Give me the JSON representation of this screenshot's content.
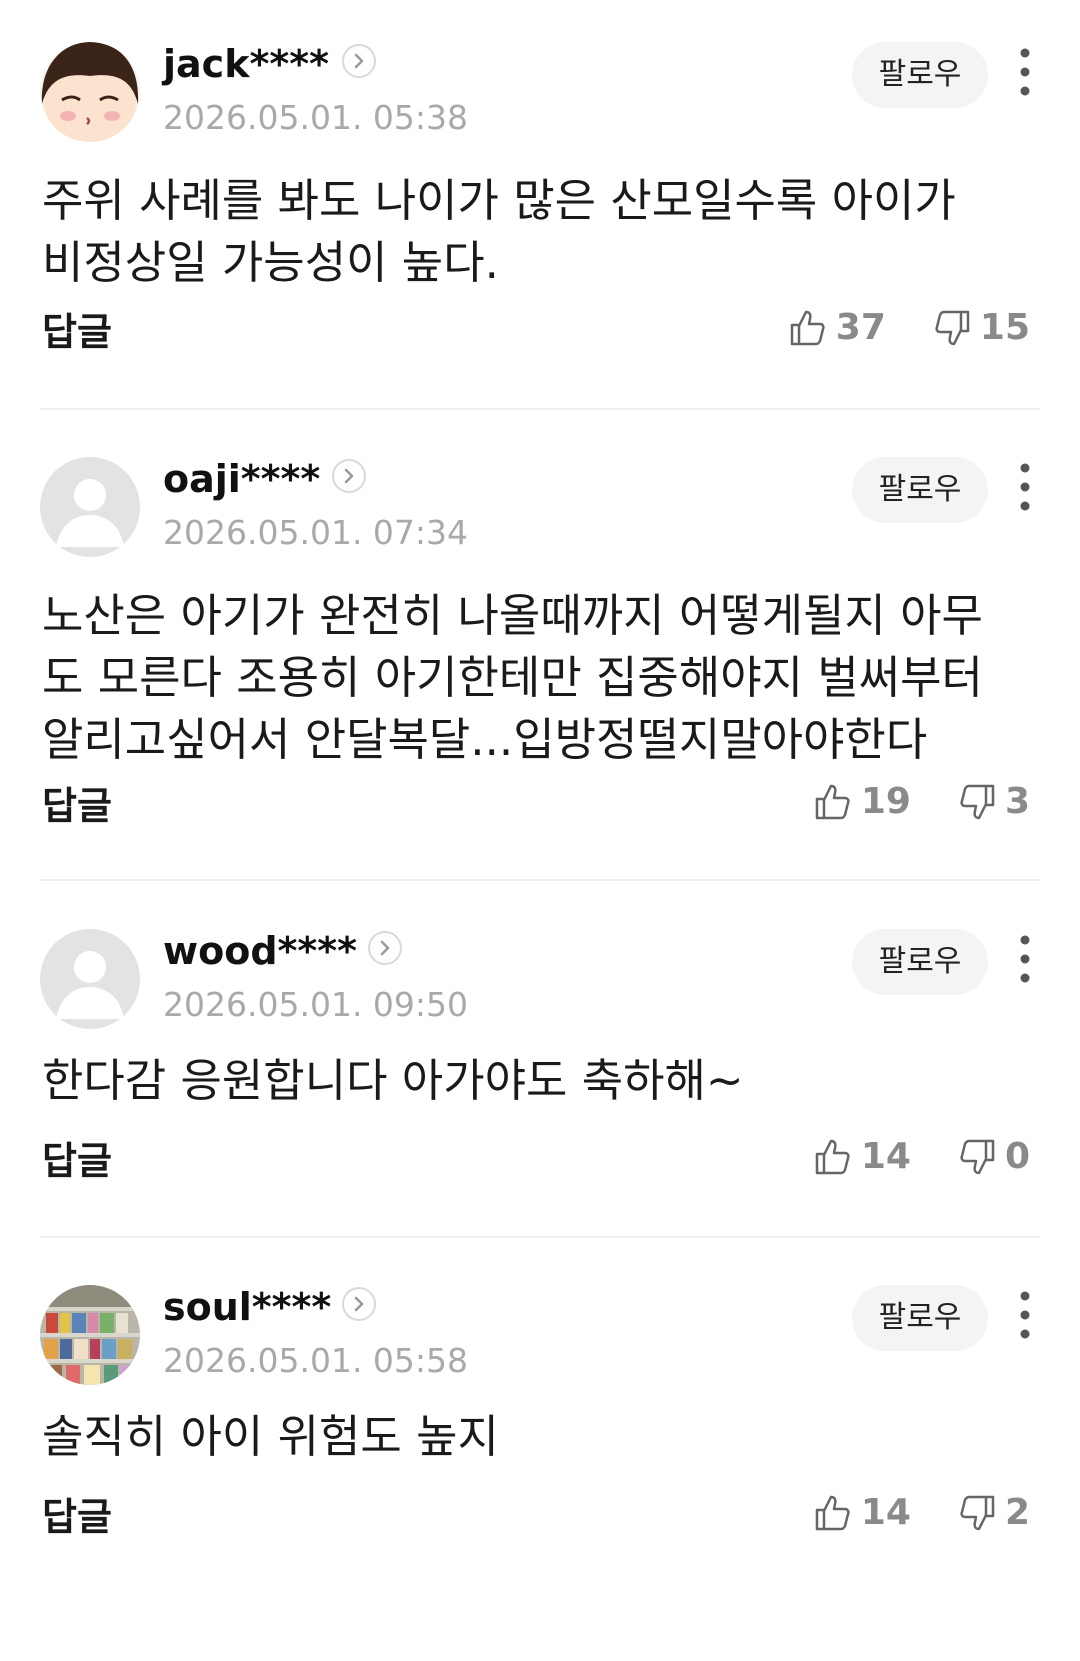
{
  "comments": [
    {
      "username": "jack****",
      "timestamp": "2026.05.01. 05:38",
      "follow_label": "팔로우",
      "body": "주위 사례를 봐도 나이가 많은 산모일수록 아이가\n비정상일 가능성이 높다.",
      "reply_label": "답글",
      "likes": "37",
      "dislikes": "15",
      "avatar": "cartoon-face"
    },
    {
      "username": "oaji****",
      "timestamp": "2026.05.01. 07:34",
      "follow_label": "팔로우",
      "body": "노산은 아기가 완전히 나올때까지 어떻게될지 아무\n도 모른다 조용히 아기한테만 집중해야지 벌써부터\n알리고싶어서 안달복달...입방정떨지말아야한다",
      "reply_label": "답글",
      "likes": "19",
      "dislikes": "3",
      "avatar": "default-user"
    },
    {
      "username": "wood****",
      "timestamp": "2026.05.01. 09:50",
      "follow_label": "팔로우",
      "body": "한다감 응원합니다 아가야도 축하해~",
      "reply_label": "답글",
      "likes": "14",
      "dislikes": "0",
      "avatar": "default-user"
    },
    {
      "username": "soul****",
      "timestamp": "2026.05.01. 05:58",
      "follow_label": "팔로우",
      "body": "솔직히 아이 위험도 높지",
      "reply_label": "답글",
      "likes": "14",
      "dislikes": "2",
      "avatar": "store-shelf-photo"
    }
  ],
  "colors": {
    "text": "#111111",
    "muted": "#a9a9a9",
    "count": "#8a8a8a",
    "follow_bg": "#f4f4f4",
    "divider": "#eeeeee"
  }
}
